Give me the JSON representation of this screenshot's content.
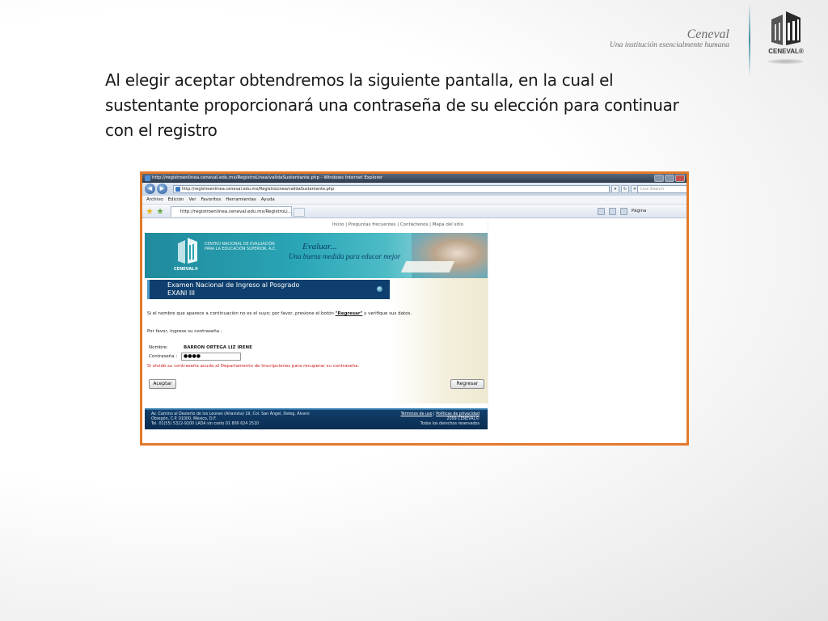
{
  "slide": {
    "brand_name": "Ceneval",
    "brand_tagline": "Una institución esencialmente humana",
    "logo_text": "CENEVAL®",
    "title": "Al elegir aceptar obtendremos la siguiente pantalla, en la cual el sustentante proporcionará una contraseña de su elección para continuar con el registro"
  },
  "browser": {
    "window_title": "http://registroenlinea.ceneval.edu.mx/RegistroLinea/validaSustentante.php - Windows Internet Explorer",
    "address": "http://registroenlinea.ceneval.edu.mx/RegistroLinea/validaSustentante.php",
    "search_placeholder": "Live Search",
    "menu": [
      "Archivo",
      "Edición",
      "Ver",
      "Favoritos",
      "Herramientas",
      "Ayuda"
    ],
    "tab_label": "http://registroenlinea.ceneval.edu.mx/RegistroLi...",
    "page_menu": "Página"
  },
  "page": {
    "top_links": "Inicio | Preguntas frecuentes | Contáctenos | Mapa del sitio",
    "banner": {
      "org_lines": "CENTRO NACIONAL DE EVALUACIÓN PARA LA EDUCACIÓN SUPERIOR, A.C.",
      "org_short": "CENEVAL®",
      "evaluar": "Evaluar...",
      "tagline": "Una buena medida para educar mejor"
    },
    "exam_title": "Examen Nacional de Ingreso al Posgrado",
    "exam_sub": "EXANI III",
    "notice_pre": "Si el nombre que aparece a continuación no es el suyo; por favor, presione el botón ",
    "notice_link": "\"Regresar\"",
    "notice_post": " y verifique sus datos.",
    "prompt": "Por favor, ingrese su contraseña :",
    "name_label": "Nombre:",
    "name_value": "BARRON ORTEGA LIZ IRENE",
    "password_label": "Contraseña :",
    "password_value": "●●●●",
    "warning": "Si olvidó su contraseña acuda al Departamento de Inscripciones para recuperar su contraseña.",
    "accept_button": "Aceptar",
    "back_button": "Regresar",
    "footer": {
      "address_1": "Av. Camino al Desierto de los Leones (Altavista) 19, Col. San Ángel, Deleg. Álvaro",
      "address_2": "Obregón, C.P. 01000, México, D.F.",
      "address_3": "Tel. 01(55) 5322-9200 LADA sin costo 01 800 624 2510",
      "terms": "Términos de uso",
      "privacy": "Políticas de privacidad",
      "copyright": "2009 CENEVAL©",
      "rights": "Todos los derechos reservados"
    }
  },
  "colors": {
    "frame_border": "#e27a2a",
    "banner_teal": "#2aa6b6",
    "exam_navy": "#0e3f6e",
    "warning_red": "#cc1a1a"
  }
}
